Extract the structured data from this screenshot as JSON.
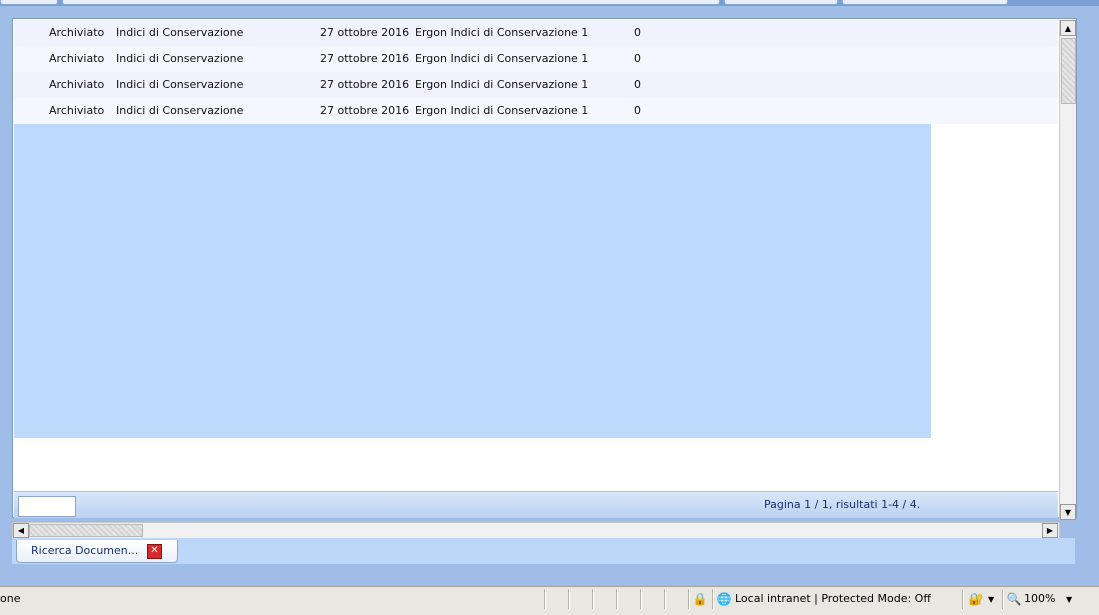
{
  "table": {
    "rows": [
      {
        "status": "Archiviato",
        "type": "Indici di Conservazione",
        "date": "27 ottobre 2016",
        "name": "Ergon Indici di Conservazione 1",
        "count": "0"
      },
      {
        "status": "Archiviato",
        "type": "Indici di Conservazione",
        "date": "27 ottobre 2016",
        "name": "Ergon Indici di Conservazione 1",
        "count": "0"
      },
      {
        "status": "Archiviato",
        "type": "Indici di Conservazione",
        "date": "27 ottobre 2016",
        "name": "Ergon Indici di Conservazione 1",
        "count": "0"
      },
      {
        "status": "Archiviato",
        "type": "Indici di Conservazione",
        "date": "27 ottobre 2016",
        "name": "Ergon Indici di Conservazione 1",
        "count": "0"
      }
    ]
  },
  "pager": {
    "input_value": "",
    "summary": "Pagina 1 / 1, risultati 1-4 / 4."
  },
  "tabs": [
    {
      "label": "Ricerca Documen...",
      "close_icon": "close-icon"
    }
  ],
  "statusbar": {
    "left_text": "one",
    "zone_text": "Local intranet | Protected Mode: Off",
    "zoom": "100%"
  },
  "colors": {
    "selection": "#bdd9fb",
    "frame": "#9fbde6",
    "close": "#d82a2a"
  }
}
